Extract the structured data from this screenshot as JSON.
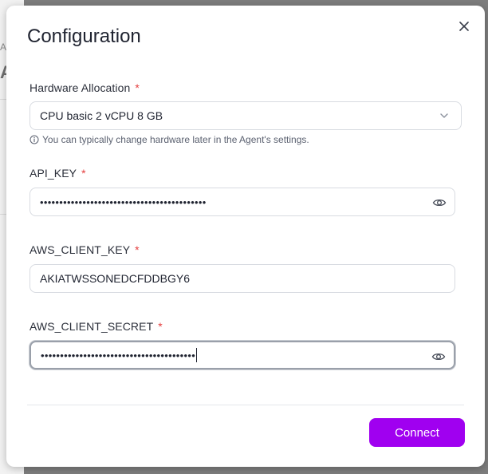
{
  "background": {
    "fragment_a": "A",
    "fragment_b": "A"
  },
  "modal": {
    "title": "Configuration",
    "close_icon": "close-icon"
  },
  "hardware": {
    "label": "Hardware Allocation",
    "required_mark": "*",
    "selected_value": "CPU basic 2 vCPU 8 GB",
    "hint": "You can typically change hardware later in the Agent's settings."
  },
  "api_key": {
    "label": "API_KEY",
    "required_mark": "*",
    "masked_value": "•••••••••••••••••••••••••••••••••••••••••••"
  },
  "aws_client_key": {
    "label": "AWS_CLIENT_KEY",
    "required_mark": "*",
    "value": "AKIATWSSONEDCFDDBGY6"
  },
  "aws_client_secret": {
    "label": "AWS_CLIENT_SECRET",
    "required_mark": "*",
    "masked_value": "••••••••••••••••••••••••••••••••••••••••"
  },
  "footer": {
    "connect_label": "Connect"
  },
  "colors": {
    "accent": "#a000f0",
    "required": "#e53e3e"
  }
}
